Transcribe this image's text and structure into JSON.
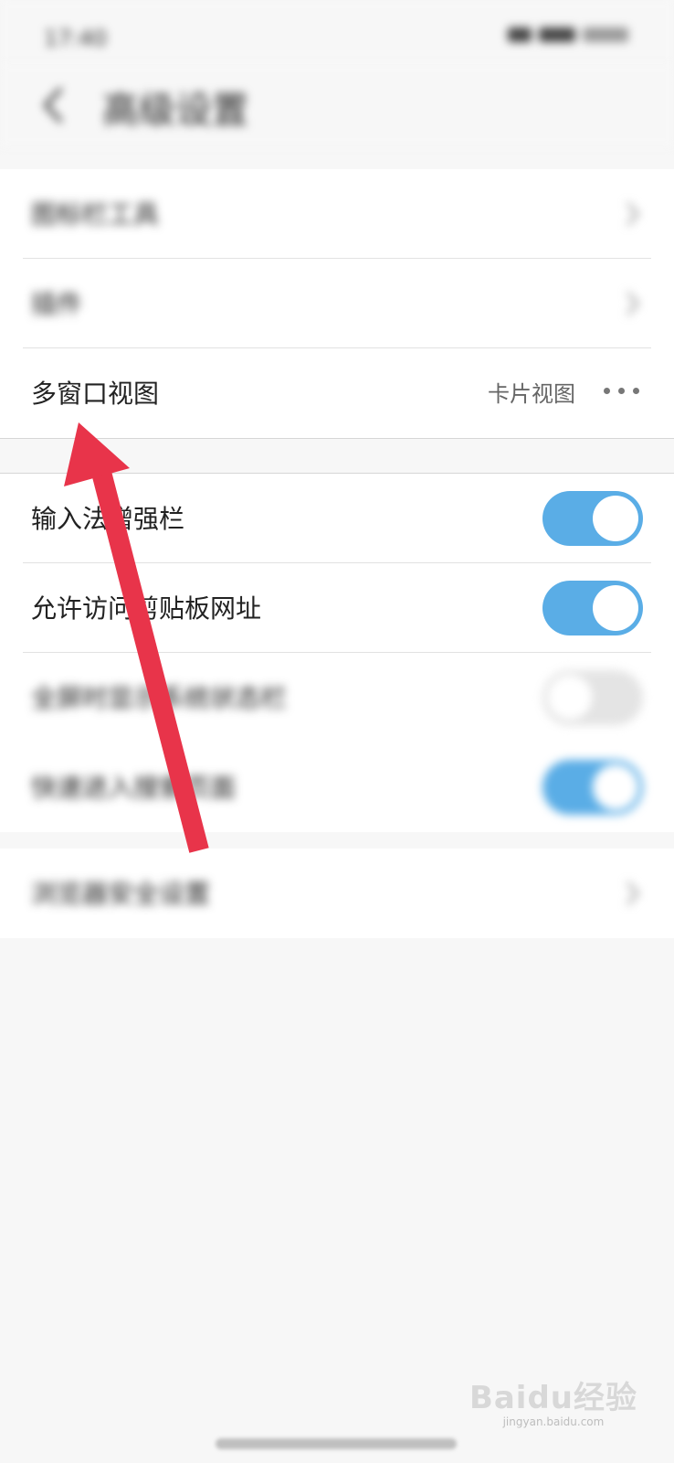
{
  "status_bar": {
    "time": "17:40",
    "icons": [
      "wifi-icon",
      "signal-icon",
      "battery-icon"
    ]
  },
  "header": {
    "title": "高级设置",
    "back_icon": "chevron-left-icon"
  },
  "group1": {
    "items": [
      {
        "label": "图标栏工具"
      },
      {
        "label": "插件"
      },
      {
        "label": "多窗口视图",
        "value": "卡片视图"
      }
    ]
  },
  "group2": {
    "items": [
      {
        "label": "输入法增强栏",
        "state": "on"
      },
      {
        "label": "允许访问剪贴板网址",
        "state": "on"
      },
      {
        "label": "全屏时显示系统状态栏",
        "state": "off"
      },
      {
        "label": "快速进入搜索页面",
        "state": "on"
      }
    ]
  },
  "group3": {
    "items": [
      {
        "label": "浏览器安全设置"
      }
    ]
  },
  "colors": {
    "accent": "#5aade6",
    "arrow": "#e8344a",
    "toggle_off": "#e4e4e4"
  },
  "watermark": {
    "brand": "Baidu经验",
    "url": "jingyan.baidu.com"
  }
}
